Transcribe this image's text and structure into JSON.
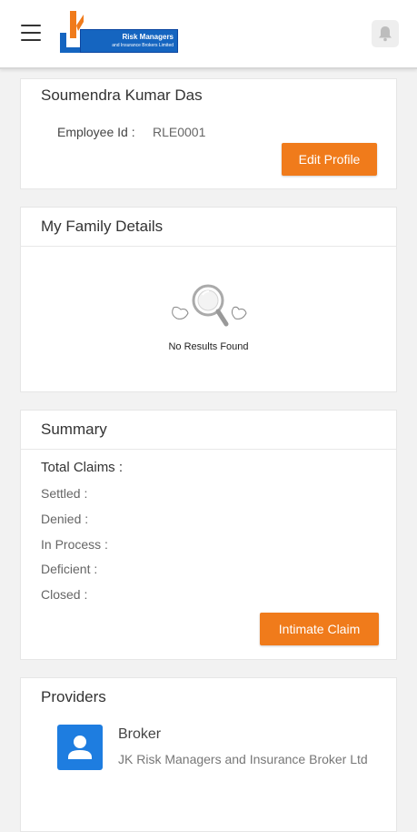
{
  "header": {
    "logo_line1": "Risk Managers",
    "logo_line2": "and Insurance Brokers Limited",
    "colors": {
      "brand_blue": "#1565c0",
      "brand_orange": "#f07b1b"
    }
  },
  "profile": {
    "name": "Soumendra Kumar Das",
    "employee_label": "Employee Id :",
    "employee_id": "RLE0001",
    "edit_button": "Edit Profile"
  },
  "family": {
    "title": "My Family Details",
    "empty_text": "No Results Found"
  },
  "summary": {
    "title": "Summary",
    "total_label": "Total Claims :",
    "rows": [
      "Settled :",
      "Denied :",
      "In Process :",
      "Deficient :",
      "Closed :"
    ],
    "intimate_button": "Intimate Claim"
  },
  "providers": {
    "title": "Providers",
    "items": [
      {
        "title": "Broker",
        "subtitle": "JK Risk Managers and Insurance Broker Ltd"
      }
    ]
  },
  "icons": [
    "menu-icon",
    "bell-icon",
    "magnifier-icon",
    "user-icon"
  ]
}
